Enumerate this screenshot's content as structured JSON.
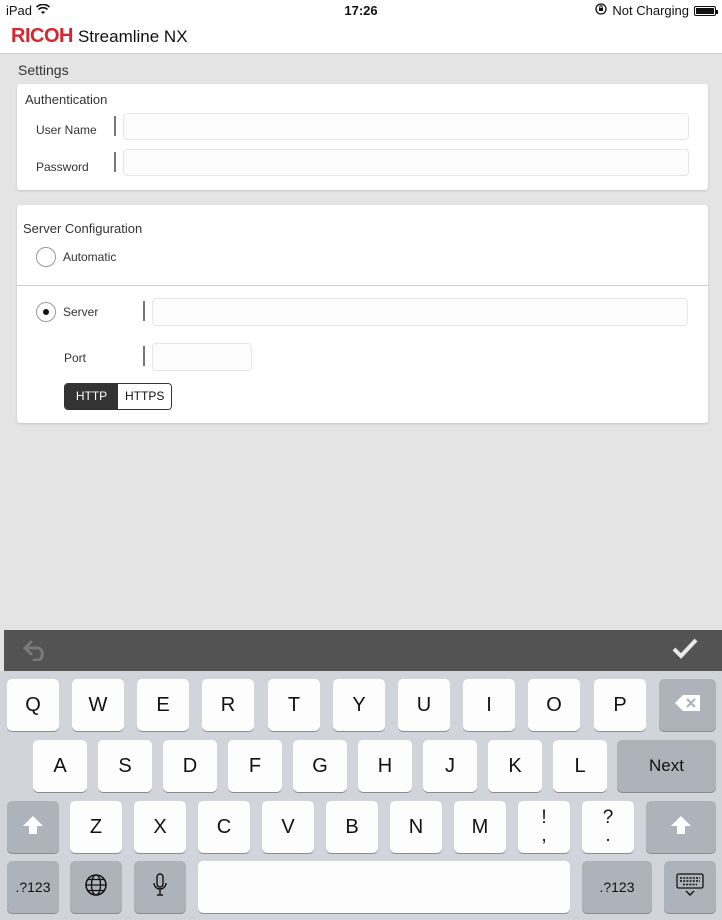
{
  "status_bar": {
    "device": "iPad",
    "time": "17:26",
    "charging": "Not Charging"
  },
  "app": {
    "brand": "RICOH",
    "name": "Streamline NX"
  },
  "page": {
    "title": "Settings"
  },
  "authentication": {
    "title": "Authentication",
    "username_label": "User Name",
    "username_value": "",
    "password_label": "Password",
    "password_value": ""
  },
  "server_config": {
    "title": "Server Configuration",
    "automatic_label": "Automatic",
    "server_label": "Server",
    "server_value": "",
    "port_label": "Port",
    "port_value": "",
    "selected_mode": "Server",
    "protocols": [
      "HTTP",
      "HTTPS"
    ],
    "selected_protocol": "HTTP"
  },
  "keyboard": {
    "row1": [
      "Q",
      "W",
      "E",
      "R",
      "T",
      "Y",
      "U",
      "I",
      "O",
      "P"
    ],
    "row2": [
      "A",
      "S",
      "D",
      "F",
      "G",
      "H",
      "J",
      "K",
      "L"
    ],
    "row3": [
      "Z",
      "X",
      "C",
      "V",
      "B",
      "N",
      "M"
    ],
    "punct1_top": "!",
    "punct1_bottom": ",",
    "punct2_top": "?",
    "punct2_bottom": ".",
    "next_label": "Next",
    "numbers_label": ".?123",
    "numbers_label_right": ".?123"
  },
  "icons": {
    "wifi": "wifi-icon",
    "orientation_lock": "orientation-lock-icon",
    "battery": "battery-icon",
    "undo": "undo-icon",
    "done": "checkmark-icon",
    "backspace": "backspace-icon",
    "shift": "shift-icon",
    "globe": "globe-icon",
    "microphone": "microphone-icon",
    "hide_keyboard": "keyboard-hide-icon"
  },
  "colors": {
    "brand_red": "#d8262f",
    "segmented_selected": "#333333",
    "toolbar": "#535353",
    "keyboard_bg": "#d1d5db"
  }
}
